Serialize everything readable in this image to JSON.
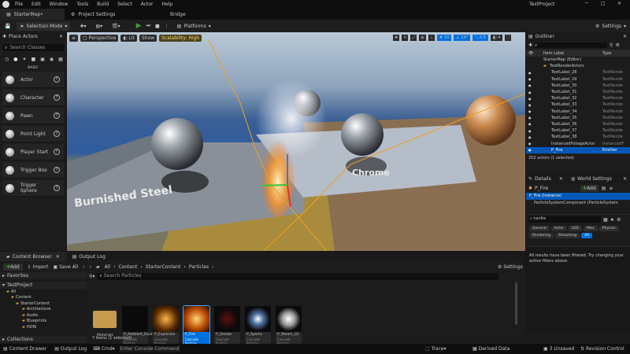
{
  "menu": [
    "File",
    "Edit",
    "Window",
    "Tools",
    "Build",
    "Select",
    "Actor",
    "Help"
  ],
  "app_title": "TestProject",
  "tabs": {
    "map": "StarterMap•",
    "project_settings": "Project Settings",
    "bridge": "Bridge"
  },
  "toolbar": {
    "selection_mode": "Selection Mode",
    "platforms": "Platforms",
    "settings": "Settings"
  },
  "viewport": {
    "perspective": "Perspective",
    "lit": "Lit",
    "show": "Show",
    "scalability": "Scalability: High",
    "grid_snap": "10",
    "angle_snap": "10°",
    "scale_snap": "0.5",
    "cam_speed": "4",
    "floor_labels": {
      "burnished": "Burnished Steel",
      "chrome": "Chrome"
    }
  },
  "place_actors": {
    "title": "Place Actors",
    "search_placeholder": "Search Classes",
    "category": "BASIC",
    "items": [
      "Actor",
      "Character",
      "Pawn",
      "Point Light",
      "Player Start",
      "Trigger Box",
      "Trigger Sphere"
    ]
  },
  "outliner": {
    "title": "Outliner",
    "col_label": "Item Label",
    "col_type": "Type",
    "map": "StarterMap (Editor)",
    "folder": "TextRenderActors",
    "rows": [
      {
        "name": "TextLabel_28",
        "type": "TextRende"
      },
      {
        "name": "TextLabel_29",
        "type": "TextRende"
      },
      {
        "name": "TextLabel_30",
        "type": "TextRende"
      },
      {
        "name": "TextLabel_31",
        "type": "TextRende"
      },
      {
        "name": "TextLabel_32",
        "type": "TextRende"
      },
      {
        "name": "TextLabel_33",
        "type": "TextRende"
      },
      {
        "name": "TextLabel_34",
        "type": "TextRende"
      },
      {
        "name": "TextLabel_35",
        "type": "TextRende"
      },
      {
        "name": "TextLabel_36",
        "type": "TextRende"
      },
      {
        "name": "TextLabel_37",
        "type": "TextRende"
      },
      {
        "name": "TextLabel_38",
        "type": "TextRende"
      },
      {
        "name": "InstancedFoliageActor",
        "type": "InstancedF"
      },
      {
        "name": "P_Fire",
        "type": "Emitter"
      }
    ],
    "status": "252 actors (1 selected)"
  },
  "details": {
    "title": "Details",
    "world_settings": "World Settings",
    "actor": "P_Fire",
    "add": "Add",
    "instance": "P_Fire (Instance)",
    "component": "ParticleSystemComponent (ParticleSystem",
    "search_value": "nanite",
    "filters": [
      "General",
      "Actor",
      "LOD",
      "Misc",
      "Physics",
      "Rendering",
      "Streaming",
      "All"
    ],
    "empty_msg": "All results have been filtered. Try changing your active filters above."
  },
  "content_browser": {
    "title": "Content Browser",
    "output_log": "Output Log",
    "add": "Add",
    "import": "Import",
    "save_all": "Save All",
    "breadcrumb": [
      "All",
      "Content",
      "StarterContent",
      "Particles"
    ],
    "settings": "Settings",
    "search_placeholder": "Search Particles",
    "favorites": "Favorites",
    "project": "TestProject",
    "tree": [
      "All",
      "Content",
      "StarterContent",
      "Architecture",
      "Audio",
      "Blueprints",
      "HDRI"
    ],
    "collections": "Collections",
    "status": "7 items (1 selected)",
    "folder": "Materials",
    "assets": [
      {
        "name": "P_Ambient_Dust",
        "type": "Cascade Particle"
      },
      {
        "name": "P_Explosion",
        "type": "Cascade Particle"
      },
      {
        "name": "P_Fire",
        "type": "Cascade Particle"
      },
      {
        "name": "P_Smoke",
        "type": "Cascade Particle"
      },
      {
        "name": "P_Sparks",
        "type": "Cascade Particle"
      },
      {
        "name": "P_Steam_Lit",
        "type": "Cascade Particle"
      }
    ]
  },
  "statusbar": {
    "drawer": "Content Drawer",
    "output_log": "Output Log",
    "cmd": "Cmd",
    "console_placeholder": "Enter Console Command",
    "trace": "Trace",
    "derived": "Derived Data",
    "unsaved": "3 Unsaved",
    "revision": "Revision Control"
  },
  "colors": {
    "accent": "#0070e0",
    "selected": "#0058b8",
    "play": "#3c9b3c",
    "scalability": "#ffd966"
  }
}
